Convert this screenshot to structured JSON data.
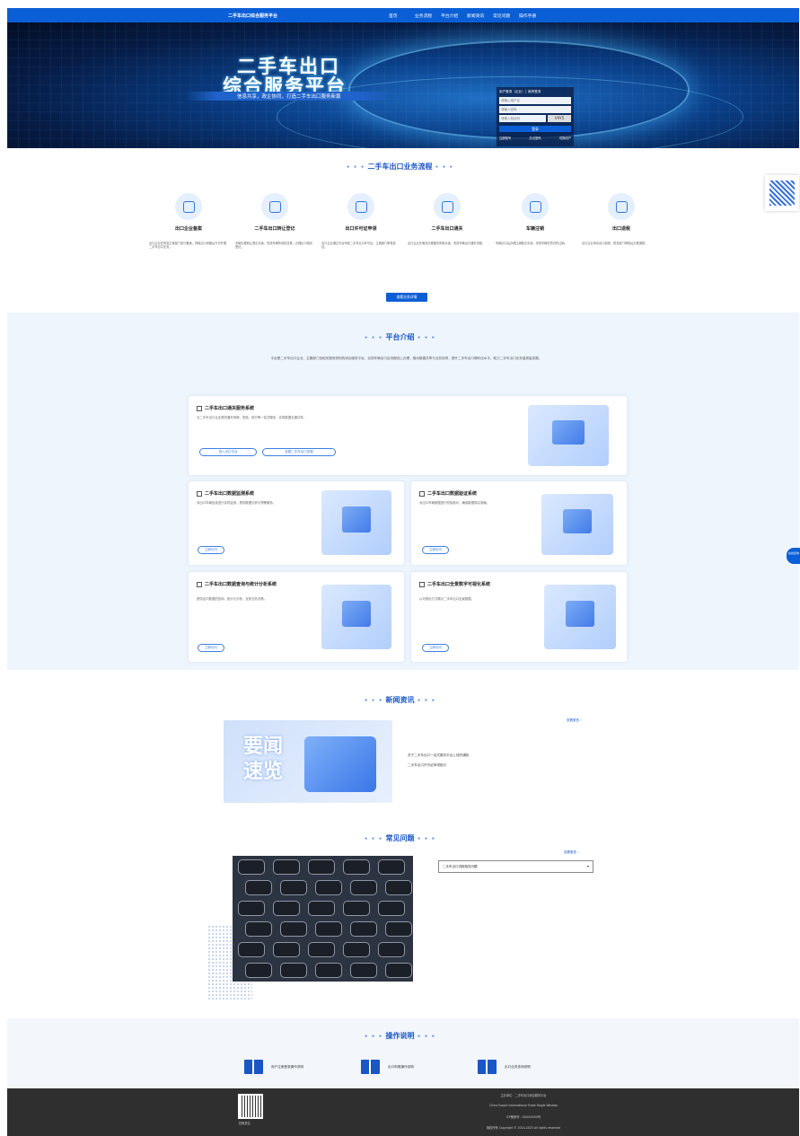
{
  "nav": {
    "brand": "二手车出口综合服务平台",
    "items": [
      "首页",
      "业务流程",
      "平台介绍",
      "新闻资讯",
      "常见问题",
      "操作手册"
    ]
  },
  "hero": {
    "title1": "二手车出口",
    "title2": "综合服务平台",
    "subtitle": "信息共享，政企协同，打造二手车出口服务新篇"
  },
  "login": {
    "title": "用户登录（企业）│ 政府登录",
    "user_placeholder": "请输入用户名",
    "pass_placeholder": "请输入密码",
    "code_placeholder": "请输入验证码",
    "captcha": "V9Y5",
    "button": "登录",
    "links": [
      "注册账号",
      "忘记密码",
      "切换用户"
    ]
  },
  "process": {
    "title": "二手车出口业务流程",
    "more": "查看业务详情",
    "steps": [
      {
        "name": "出口企业备案",
        "desc": "出口企业在商务主管部门进行备案，获取出口资格后方可开展二手车出口业务。"
      },
      {
        "name": "二手车出口转让登记",
        "desc": "车辆办理转让登记手续，完成车辆所有权变更，办理出口相关登记。"
      },
      {
        "name": "出口许可证申领",
        "desc": "出口企业通过平台申领二手车出口许可证，主管部门审核发证。"
      },
      {
        "name": "二手车出口通关",
        "desc": "出口企业在海关办理通关申报手续，完成车辆出口通关流程。"
      },
      {
        "name": "车辆注销",
        "desc": "车辆出口后办理注销登记手续，完成车辆在境内的注销。"
      },
      {
        "name": "出口退税",
        "desc": "出口企业申请出口退税，税务部门审核后办理退税。"
      }
    ]
  },
  "platform": {
    "title": "平台介绍",
    "intro": "平台是二手车出口企业、主管部门及相关服务机构的综合服务平台，实现车辆出口全流程线上办理，推动数据共享与业务协同，提升二手车出口便利化水平，助力二手车出口业务高质量发展。",
    "cards": [
      {
        "title": "二手车出口通关服务系统",
        "desc": "为二手车出口企业提供通关申报、查验、放行等一站式服务，实现数据互通共享。",
        "btns": [
          "进入出口平台",
          "查看二手车出口流程"
        ]
      },
      {
        "title": "二手车出口数据监测系统",
        "desc": "对出口车辆信息进行实时监测，提供数据分析与预警服务。",
        "btns": [
          "立即访问"
        ]
      },
      {
        "title": "二手车出口数据验证系统",
        "desc": "对出口车辆数据进行校验核对，确保数据真实准确。",
        "btns": [
          "立即访问"
        ]
      },
      {
        "title": "二手车出口数据查询与统计分析系统",
        "desc": "提供出口数据的查询、统计与分析，支撑业务决策。",
        "btns": [
          "立即访问"
        ]
      },
      {
        "title": "二手车出口全景数字可视化系统",
        "desc": "以可视化方式展示二手车出口全景数据。",
        "btns": [
          "立即访问"
        ]
      }
    ]
  },
  "news": {
    "title": "新闻资讯",
    "more": "查看更多 ›",
    "image_text": "要闻速览",
    "items": [
      "关于二手车出口一站式服务平台上线的通知",
      "二手车出口许可证申领指引"
    ]
  },
  "faq": {
    "title": "常见问题",
    "more": "查看更多 ›",
    "selected": "二手车出口流程相关问题"
  },
  "ops": {
    "title": "操作说明",
    "items": [
      "用户注册登录操作说明",
      "出口申报操作说明",
      "出口业务查询说明"
    ]
  },
  "float": {
    "side": "在线咨询"
  },
  "footer": {
    "qr_label": "扫码关注",
    "lines": [
      "主办单位：二手车出口综合服务平台",
      "China Export International Trade Single Window",
      "ICP备案号：XXXXXXXX号",
      "版权所有 Copyright © 2014-2023 All rights reserved"
    ]
  }
}
